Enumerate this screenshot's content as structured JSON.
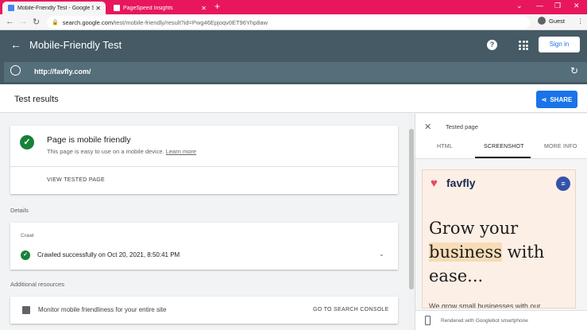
{
  "browser": {
    "tabs": [
      {
        "label": "Mobile-Friendly Test - Google Se",
        "active": true
      },
      {
        "label": "PageSpeed Insights",
        "active": false
      }
    ],
    "new_tab": "+",
    "url_host": "search.google.com",
    "url_path": "/test/mobile-friendly/result?id=Pwg46Epjoqv0ET96Yhp8aw",
    "profile": "Guest",
    "accent": "#e8175d"
  },
  "app": {
    "title": "Mobile-Friendly Test",
    "sign_in": "Sign in",
    "tested_url": "http://favfly.com/",
    "header_color": "#455a64"
  },
  "results": {
    "heading": "Test results",
    "share": "SHARE",
    "verdict": "Page is mobile friendly",
    "description": "This page is easy to use on a mobile device.",
    "learn_more": "Learn more",
    "view_tested": "VIEW TESTED PAGE",
    "details_label": "Details",
    "crawl_label": "Crawl",
    "crawl_status": "Crawled successfully on Oct 20, 2021, 8:50:41 PM",
    "additional_label": "Additional resources",
    "monitor_text": "Monitor mobile friendliness for your entire site",
    "console_link": "GO TO SEARCH CONSOLE"
  },
  "panel": {
    "title": "Tested page",
    "tabs": [
      "HTML",
      "SCREENSHOT",
      "MORE INFO"
    ],
    "active_tab": "SCREENSHOT",
    "preview": {
      "brand": "favfly",
      "hero_line1": "Grow your",
      "hero_highlight": "business",
      "hero_rest": " with",
      "hero_line3": "ease...",
      "sub": "We grow small businesses with our"
    },
    "footer": "Rendered with Googlebot smartphone"
  }
}
